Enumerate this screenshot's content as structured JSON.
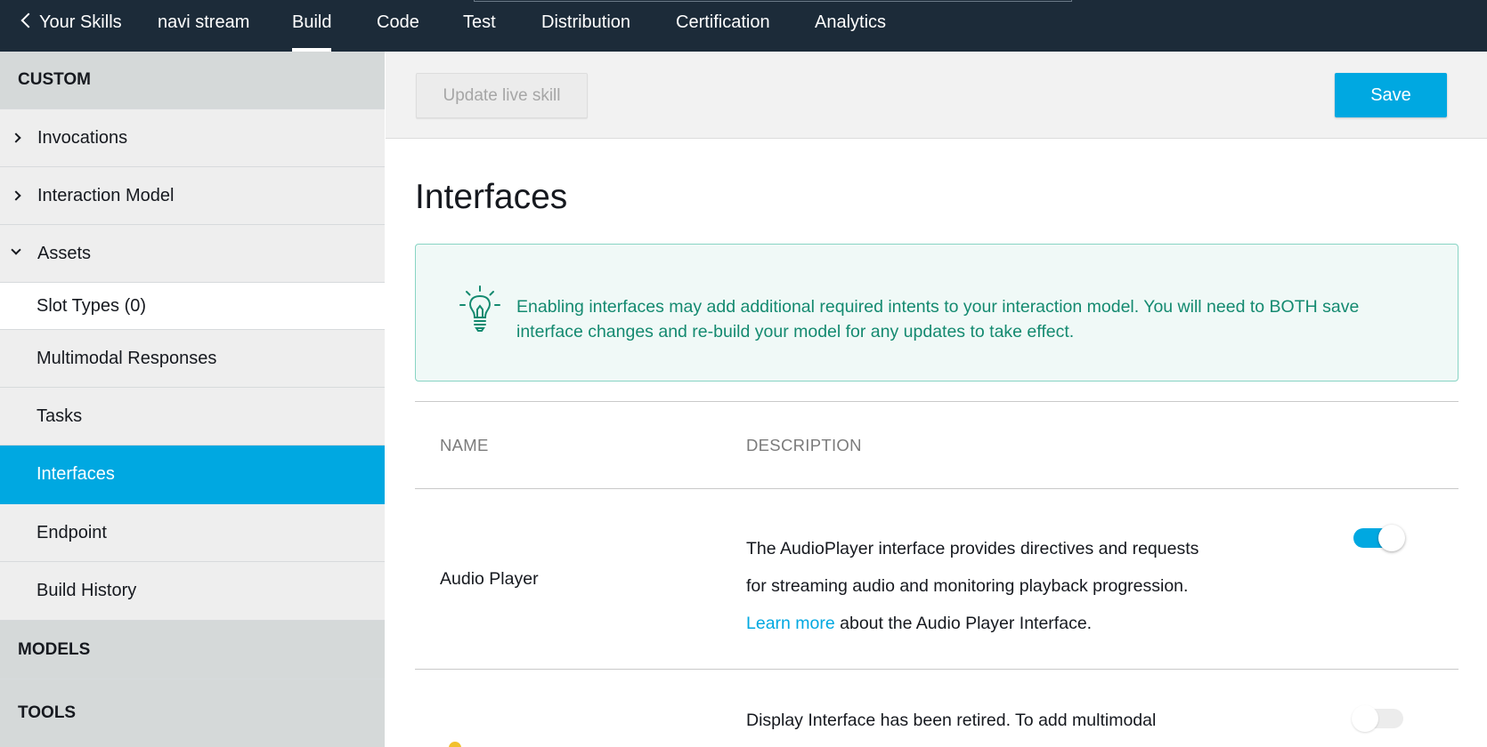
{
  "topnav": {
    "back_label": "Your Skills",
    "skill_name": "navi stream",
    "tabs": [
      {
        "label": "Build"
      },
      {
        "label": "Code"
      },
      {
        "label": "Test"
      },
      {
        "label": "Distribution"
      },
      {
        "label": "Certification"
      },
      {
        "label": "Analytics"
      }
    ]
  },
  "sidebar": {
    "custom_section": "CUSTOM",
    "invocations": "Invocations",
    "interaction_model": "Interaction Model",
    "assets": "Assets",
    "slot_types": "Slot Types (0)",
    "multimodal": "Multimodal Responses",
    "tasks": "Tasks",
    "interfaces": "Interfaces",
    "endpoint": "Endpoint",
    "build_history": "Build History",
    "models_section": "MODELS",
    "tools_section": "TOOLS"
  },
  "toolbar": {
    "update_label": "Update live skill",
    "save_label": "Save"
  },
  "page": {
    "title": "Interfaces",
    "info_text": "Enabling interfaces may add additional required intents to your interaction model. You will need to BOTH save interface changes and re-build your model for any updates to take effect."
  },
  "table": {
    "col_name": "NAME",
    "col_description": "DESCRIPTION",
    "rows": [
      {
        "name": "Audio Player",
        "desc_line1": "The AudioPlayer interface provides directives and requests",
        "desc_line2": "for streaming audio and monitoring playback progression.",
        "link_text": "Learn more",
        "link_suffix": " about the Audio Player Interface.",
        "enabled": true
      },
      {
        "name": "",
        "desc_line1": "Display Interface has been retired. To add multimodal",
        "enabled": false
      }
    ]
  },
  "colors": {
    "nav_bg": "#1c2b39",
    "accent": "#00a8e1",
    "info_text": "#148a70",
    "info_bg": "#f0f9f7"
  }
}
